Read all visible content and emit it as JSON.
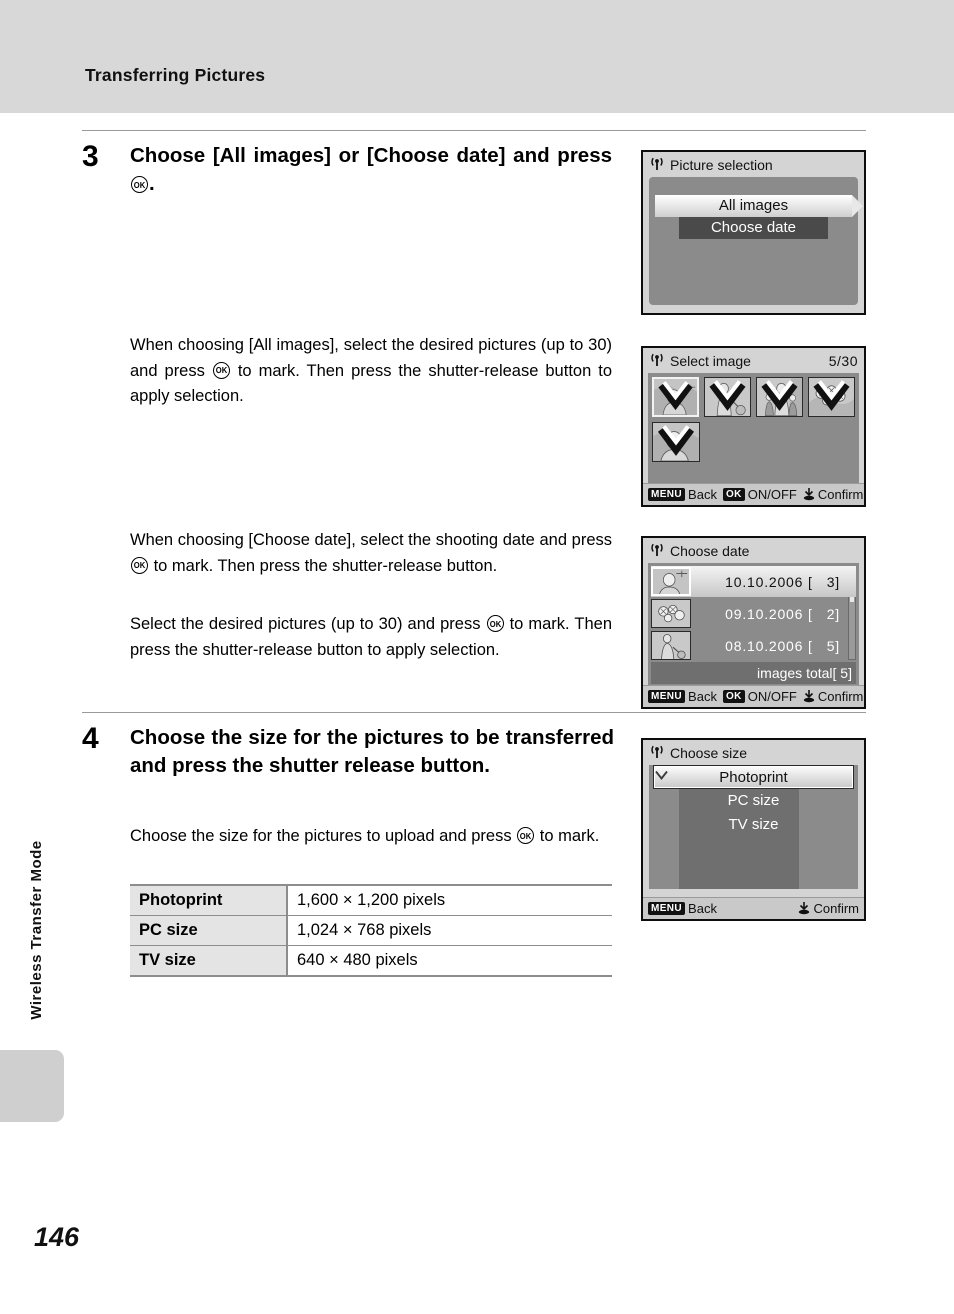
{
  "header": {
    "title": "Transferring Pictures"
  },
  "sidebar": {
    "vertical_label": "Wireless Transfer Mode"
  },
  "page": {
    "number": "146"
  },
  "steps": [
    {
      "number": "3",
      "heading_parts": {
        "a": "Choose [All images] or [Choose date] and press ",
        "icon": "ok-button-icon",
        "b": "."
      }
    },
    {
      "number": "4",
      "heading": "Choose the size for the pictures to be transferred and press the shutter release button."
    }
  ],
  "paragraphs": {
    "p1_a": "When choosing [All images], select the desired pictures (up to 30) and press ",
    "p1_b": " to mark. Then press the shutter-release button to apply selection.",
    "p2_a": "When choosing [Choose date], select the shooting date and press ",
    "p2_b": " to mark. Then press the shutter-release button.",
    "p3_a": "Select the desired pictures (up to 30) and press ",
    "p3_b": " to mark. Then press the shutter-release button to apply selection.",
    "p4_a": "Choose the size for the pictures to upload and press ",
    "p4_b": " to mark."
  },
  "size_table": {
    "rows": [
      {
        "name": "Photoprint",
        "value": "1,600 × 1,200 pixels"
      },
      {
        "name": "PC size",
        "value": "1,024 × 768 pixels"
      },
      {
        "name": "TV size",
        "value": "640 × 480 pixels"
      }
    ]
  },
  "lcd_screens": [
    {
      "id": "picture-selection",
      "title": "Picture selection",
      "wifi_icon": "wireless-antenna-icon",
      "items": [
        {
          "label": "All images",
          "selected": true
        },
        {
          "label": "Choose date",
          "selected": false
        }
      ]
    },
    {
      "id": "select-image",
      "title": "Select image",
      "wifi_icon": "wireless-antenna-icon",
      "counter": "5/30",
      "thumbnails": [
        {
          "marked": true,
          "current": true
        },
        {
          "marked": true,
          "current": false
        },
        {
          "marked": true,
          "current": false
        },
        {
          "marked": true,
          "current": false
        },
        {
          "marked": true,
          "current": false
        }
      ],
      "bar": {
        "menu_key": "MENU",
        "back_label": "Back",
        "ok_key": "OK",
        "onoff_label": "ON/OFF",
        "confirm_icon": "shutter-release-icon",
        "confirm_label": "Confirm"
      }
    },
    {
      "id": "choose-date",
      "title": "Choose date",
      "wifi_icon": "wireless-antenna-icon",
      "rows": [
        {
          "date": "10.10.2006",
          "count": "3]",
          "bracket": "[",
          "selected": true
        },
        {
          "date": "09.10.2006",
          "count": "2]",
          "bracket": "[",
          "selected": false
        },
        {
          "date": "08.10.2006",
          "count": "5]",
          "bracket": "[",
          "selected": false
        }
      ],
      "total_label": "images total",
      "total_value": "[    5]",
      "bar": {
        "menu_key": "MENU",
        "back_label": "Back",
        "ok_key": "OK",
        "onoff_label": "ON/OFF",
        "confirm_icon": "shutter-release-icon",
        "confirm_label": "Confirm"
      }
    },
    {
      "id": "choose-size",
      "title": "Choose size",
      "wifi_icon": "wireless-antenna-icon",
      "mark_icon": "transfer-mark-icon",
      "items": [
        {
          "label": "Photoprint",
          "selected": true
        },
        {
          "label": "PC size",
          "selected": false
        },
        {
          "label": "TV size",
          "selected": false
        }
      ],
      "bar": {
        "menu_key": "MENU",
        "back_label": "Back",
        "confirm_icon": "shutter-release-icon",
        "confirm_label": "Confirm"
      }
    }
  ],
  "colors": {
    "header_band": "#d8d8d8",
    "lcd_background": "#d4d4d4",
    "lcd_panel": "#8b8b8b",
    "rule": "#9a9a9a",
    "table_key_bg": "#e4e4e4"
  }
}
